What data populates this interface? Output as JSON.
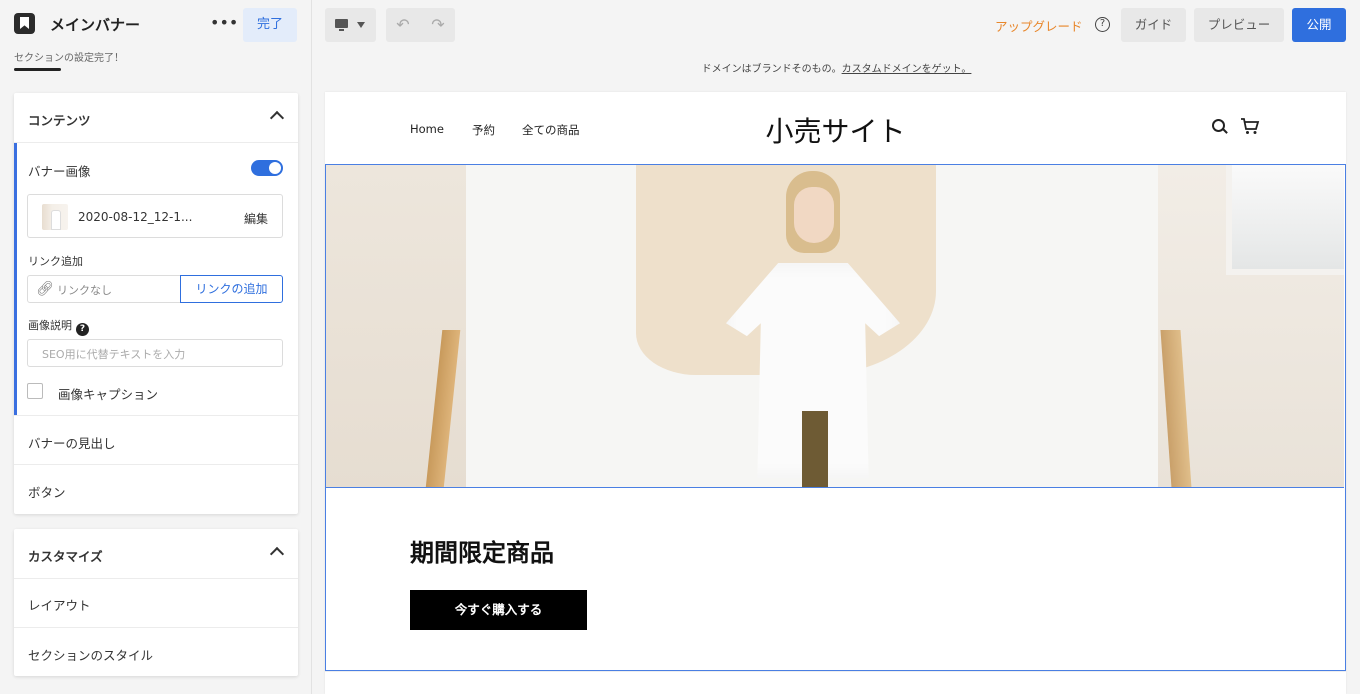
{
  "left_panel": {
    "title": "メインバナー",
    "more": "•••",
    "done": "完了",
    "status": "セクションの設定完了！",
    "content_card": {
      "title": "コンテンツ",
      "banner_image_label": "バナー画像",
      "banner_image_enabled": true,
      "file_name": "2020-08-12_12-1...",
      "edit": "編集",
      "link_label": "リンク追加",
      "link_placeholder": "リンクなし",
      "link_add": "リンクの追加",
      "alt_label": "画像説明",
      "alt_placeholder": "SEO用に代替テキストを入力",
      "caption_label": "画像キャプション",
      "caption_checked": false,
      "rows": [
        "バナーの見出し",
        "ボタン"
      ]
    },
    "customize_card": {
      "title": "カスタマイズ",
      "rows": [
        "レイアウト",
        "セクションのスタイル"
      ]
    }
  },
  "toolbar": {
    "upgrade": "アップグレード",
    "help": "?",
    "guide": "ガイド",
    "preview": "プレビュー",
    "publish": "公開"
  },
  "preview": {
    "domain_notice": "ドメインはブランドそのもの。",
    "domain_link": "カスタムドメインをゲット。",
    "site": {
      "nav": [
        "Home",
        "予約",
        "全ての商品"
      ],
      "logo": "小売サイト",
      "banner_title": "期間限定商品",
      "cta": "今すぐ購入する"
    }
  },
  "colors": {
    "accent": "#2f6fde",
    "upgrade": "#e8862a",
    "selection": "#4a7fe3"
  }
}
